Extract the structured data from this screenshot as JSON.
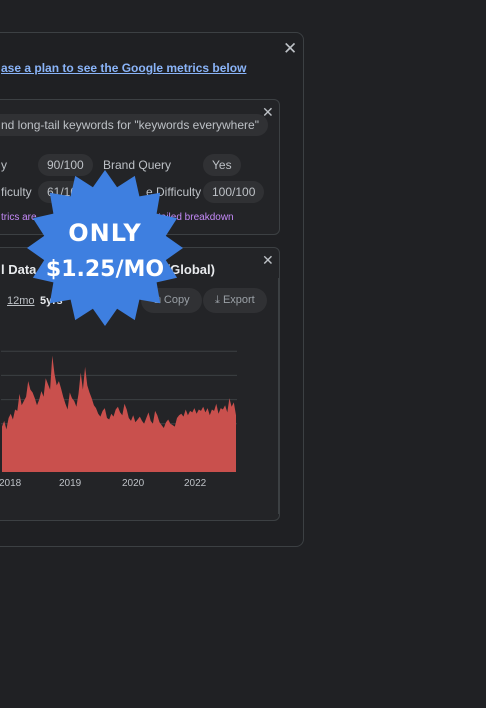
{
  "plan_link": "ase a plan to see the Google metrics below",
  "close_glyph": "✕",
  "seo_card": {
    "search_chip": "nd long-tail keywords for \"keywords everywhere\"",
    "row1": {
      "label_a": "y",
      "value_a": "90/100",
      "label_b": "Brand Query",
      "value_b": "Yes"
    },
    "row2": {
      "label_a": "ficulty",
      "value_a": "61/10",
      "label_b": "e Difficulty",
      "value_b": "100/100"
    },
    "note_left": "trics are",
    "note_right": "tailed breakdown"
  },
  "trend_card": {
    "title_left": "l Data",
    "title_right": "e (Global)",
    "range_12mo": "12mo",
    "range_5yrs": "5yrs",
    "copy_label": "Copy",
    "export_label": "Export"
  },
  "promo": {
    "line1": "ONLY",
    "line2": "$1.25/MO",
    "color": "#3e7fe0"
  },
  "chart_data": {
    "type": "area",
    "color": "#c9504d",
    "x_ticks": [
      "2018",
      "2019",
      "2020",
      "2022"
    ],
    "grid": true,
    "values": [
      32,
      36,
      30,
      38,
      41,
      37,
      44,
      43,
      55,
      47,
      50,
      53,
      64,
      58,
      56,
      52,
      47,
      51,
      57,
      53,
      66,
      62,
      58,
      82,
      69,
      61,
      64,
      59,
      53,
      48,
      44,
      56,
      52,
      50,
      46,
      55,
      70,
      58,
      74,
      61,
      56,
      52,
      47,
      45,
      41,
      39,
      43,
      45,
      38,
      37,
      41,
      39,
      44,
      46,
      42,
      40,
      48,
      44,
      38,
      36,
      40,
      35,
      37,
      39,
      36,
      34,
      38,
      42,
      36,
      34,
      43,
      40,
      35,
      33,
      31,
      35,
      37,
      34,
      33,
      32,
      38,
      40,
      41,
      39,
      44,
      40,
      43,
      42,
      45,
      41,
      44,
      43,
      46,
      42,
      45,
      40,
      44,
      43,
      48,
      41,
      45,
      44,
      47,
      42,
      52,
      46,
      49,
      40
    ],
    "ylim": [
      0,
      100
    ]
  }
}
